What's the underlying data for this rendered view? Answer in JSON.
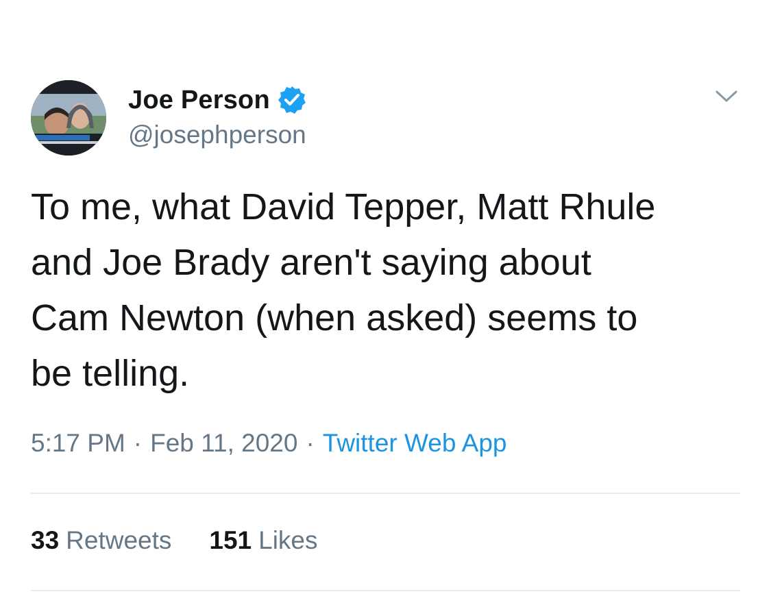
{
  "author": {
    "display_name": "Joe Person",
    "handle": "@josephperson",
    "verified": true
  },
  "tweet": {
    "text": "To me, what David Tepper, Matt Rhule\nand Joe Brady aren't saying about\nCam Newton (when asked) seems to\nbe telling.",
    "time": "5:17 PM",
    "separator": "·",
    "date": "Feb 11, 2020",
    "source": "Twitter Web App"
  },
  "stats": {
    "retweets_count": "33",
    "retweets_label": "Retweets",
    "likes_count": "151",
    "likes_label": "Likes"
  },
  "colors": {
    "text": "#14171a",
    "secondary": "#657786",
    "link": "#1b95e0",
    "verified": "#1da1f2",
    "divider": "#e6ecf0"
  },
  "icons": {
    "verified": "verified-badge-icon",
    "caret": "chevron-down-icon"
  }
}
